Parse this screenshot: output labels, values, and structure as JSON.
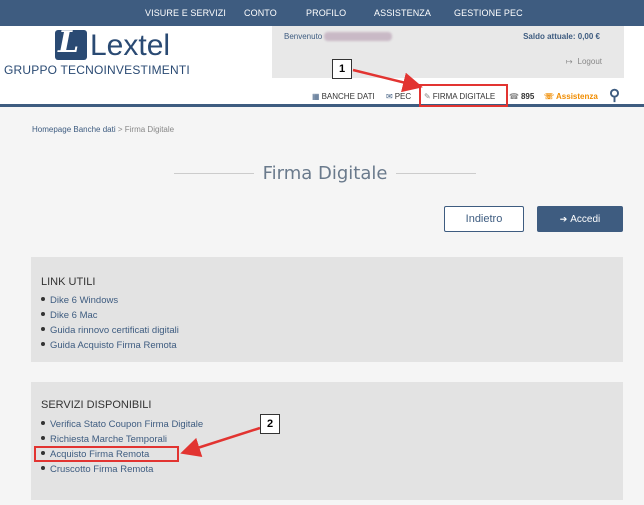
{
  "topnav": {
    "items": [
      "VISURE E SERVIZI",
      "CONTO",
      "PROFILO",
      "ASSISTENZA",
      "GESTIONE PEC"
    ]
  },
  "logo": {
    "glyph": "L",
    "name": "Lextel",
    "subtitle": "GRUPPO TECNOINVESTIMENTI"
  },
  "user": {
    "welcome": "Benvenuto",
    "saldo": "Saldo attuale: 0,00 €",
    "logout": "Logout",
    "logout_icon": "↦"
  },
  "subnav": {
    "banche_dati": "BANCHE DATI",
    "banche_icon": "▦",
    "pec": "PEC",
    "pec_icon": "✉",
    "firma": "FIRMA DIGITALE",
    "firma_icon": "✎",
    "phone": "895",
    "phone_icon": "☎",
    "assistenza": "Assistenza",
    "assistenza_icon": "☏",
    "search_icon": "⚲"
  },
  "breadcrumb": {
    "home": "Homepage Banche dati",
    "separator": " > ",
    "current": "Firma Digitale"
  },
  "page": {
    "title": "Firma Digitale"
  },
  "buttons": {
    "back": "Indietro",
    "login": "Accedi",
    "login_icon": "➔"
  },
  "link_utili": {
    "title": "LINK UTILI",
    "items": [
      "Dike 6 Windows",
      "Dike 6 Mac",
      "Guida rinnovo certificati digitali",
      "Guida Acquisto Firma Remota"
    ]
  },
  "servizi": {
    "title": "SERVIZI DISPONIBILI",
    "items": [
      "Verifica Stato Coupon Firma Digitale",
      "Richiesta Marche Temporali",
      "Acquisto Firma Remota",
      "Cruscotto Firma Remota"
    ]
  },
  "callouts": [
    "1",
    "2"
  ],
  "colors": {
    "brand": "#3e5c80",
    "highlight": "#e23431",
    "assistenza": "#f08c00"
  }
}
